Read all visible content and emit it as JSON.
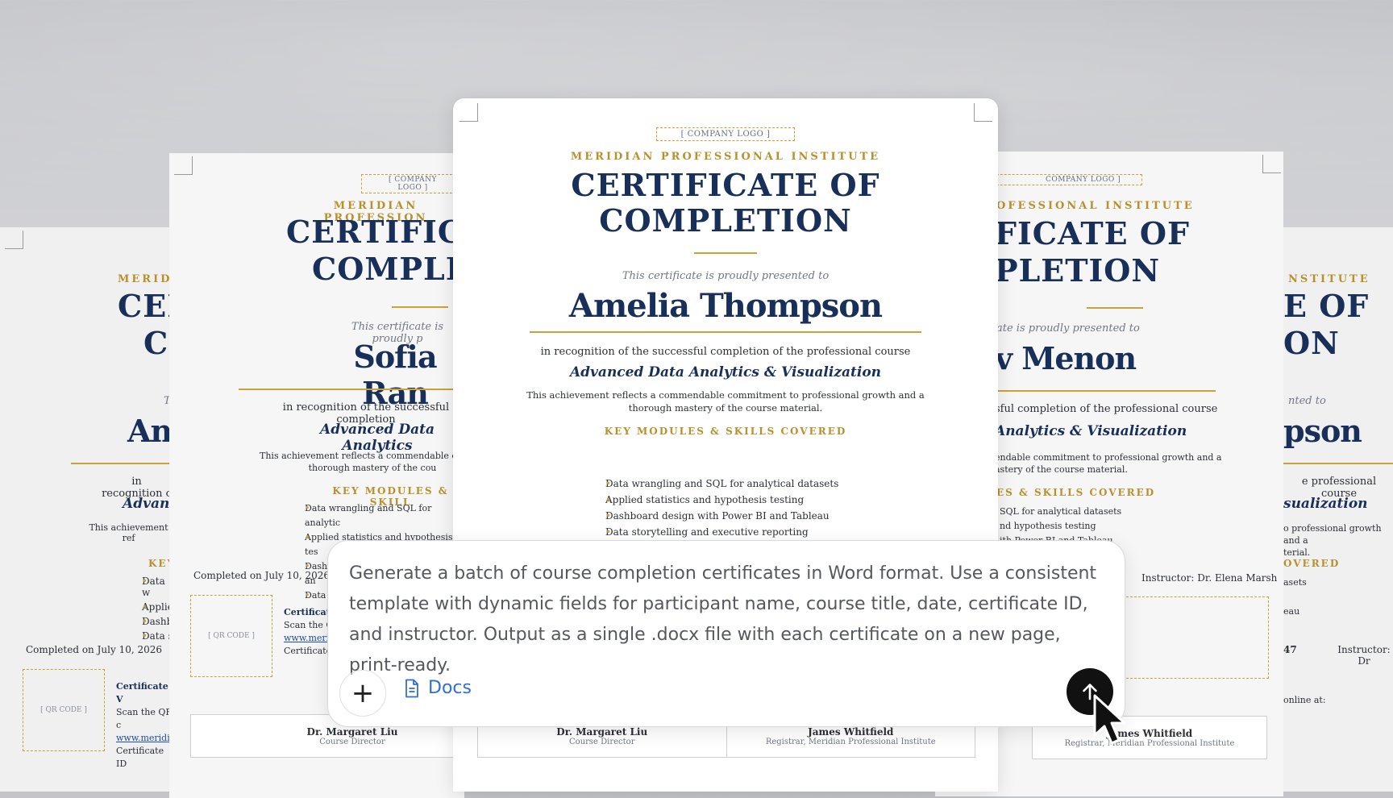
{
  "prompt": {
    "text": "Generate a batch of course completion certificates in Word format. Use a consistent template with dynamic fields for participant name, course title, date, certificate ID, and instructor. Output as a single .docx file with each certificate on a new page, print-ready.",
    "attach_label": "+",
    "tool_label": "Docs"
  },
  "center": {
    "logo": "[ COMPANY LOGO ]",
    "institute": "MERIDIAN PROFESSIONAL INSTITUTE",
    "title_line1": "CERTIFICATE OF",
    "title_line2": "COMPLETION",
    "presented": "This certificate is proudly presented to",
    "name": "Amelia Thompson",
    "recognition": "in recognition of the successful completion of the professional course",
    "course": "Advanced Data Analytics & Visualization",
    "achievement_l1": "This achievement reflects a commendable commitment to professional growth and a",
    "achievement_l2": "thorough mastery of the course material.",
    "modules_heading": "KEY MODULES & SKILLS COVERED",
    "modules": [
      "Data wrangling and SQL for analytical datasets",
      "Applied statistics and hypothesis testing",
      "Dashboard design with Power BI and Tableau",
      "Data storytelling and executive reporting"
    ],
    "sig1_name": "Dr. Margaret Liu",
    "sig1_role": "Course Director",
    "sig2_name": "James Whitfield",
    "sig2_role": "Registrar, Meridian Professional Institute"
  },
  "left": {
    "logo": "[ COMPANY LOGO ]",
    "institute": "MERIDIAN PROFESSION",
    "title_line1": "CERTIFICA",
    "title_line2": "COMPLET",
    "presented": "This certificate is proudly p",
    "name": "Sofia Ran",
    "recognition": "in recognition of the successful completion",
    "course": "Advanced Data Analytics",
    "achievement_l1": "This achievement reflects a commendable commit",
    "achievement_l2": "thorough mastery of the cou",
    "modules_heading": "KEY MODULES & SKILL",
    "modules": [
      "Data wrangling and SQL for analytic",
      "Applied statistics and hypothesis tes",
      "Dashboard design with Power BI an",
      "Data"
    ],
    "completed": "Completed on July 10, 2026",
    "qr": "[ QR CODE ]",
    "verify_title": "Certificate",
    "verify_l1": "Scan the QR",
    "verify_link": "www.merid",
    "verify_id": "Certificate",
    "sig1_name": "Dr. Margaret Liu",
    "sig1_role": "Course Director"
  },
  "farleft": {
    "institute": "MERIDI",
    "title_line1": "CEI",
    "title_line2": "C",
    "presented": "T",
    "name": "An",
    "recognition": "in recognition c",
    "course": "Advanc",
    "achievement": "This achievement ref",
    "modules_heading": "KEY",
    "modules": [
      "Data w",
      "Applie",
      "Dashb",
      "Data s"
    ],
    "completed": "Completed on July 10, 2026",
    "qr": "[ QR CODE ]",
    "verify_title": "Certificate V",
    "verify_l1": "Scan the QR c",
    "verify_link": "www.meridia",
    "verify_id": "Certificate ID"
  },
  "right": {
    "logo": "COMPANY LOGO ]",
    "institute": "OFESSIONAL INSTITUTE",
    "title_line1": "FICATE OF",
    "title_line2": "PLETION",
    "presented": "ate is proudly presented to",
    "name": "v Menon",
    "recognition": "sful completion of the professional course",
    "course": "Analytics & Visualization",
    "achievement_l1": "endable commitment to professional growth and a",
    "achievement_l2": "astery of the course material.",
    "modules_heading": "ES & SKILLS COVERED",
    "modules": [
      "SQL for analytical datasets",
      "nd hypothesis testing",
      "ith Power BI and Tableau"
    ],
    "instructor": "Instructor: Dr. Elena Marsh",
    "sig2_name": "James Whitfield",
    "sig2_role": "Registrar, Meridian Professional Institute"
  },
  "farright": {
    "institute": "NSTITUTE",
    "title_line1": "E OF",
    "title_line2": "ON",
    "presented": "nted to",
    "name": "pson",
    "recognition": "e professional course",
    "course": "sualization",
    "achievement_l1": "o professional growth and a",
    "achievement_l2": "terial.",
    "modules_heading": "OVERED",
    "modules": [
      "asets",
      "eau"
    ],
    "id_fragment": "47",
    "instructor": "Instructor: Dr",
    "verify": "online at:"
  },
  "colors": {
    "navy": "#172f59",
    "gold": "#b8912c",
    "link": "#1e4fa8",
    "send_button": "#111111"
  },
  "icons": [
    "plus-icon",
    "document-icon",
    "arrow-up-icon",
    "mouse-pointer-icon"
  ]
}
